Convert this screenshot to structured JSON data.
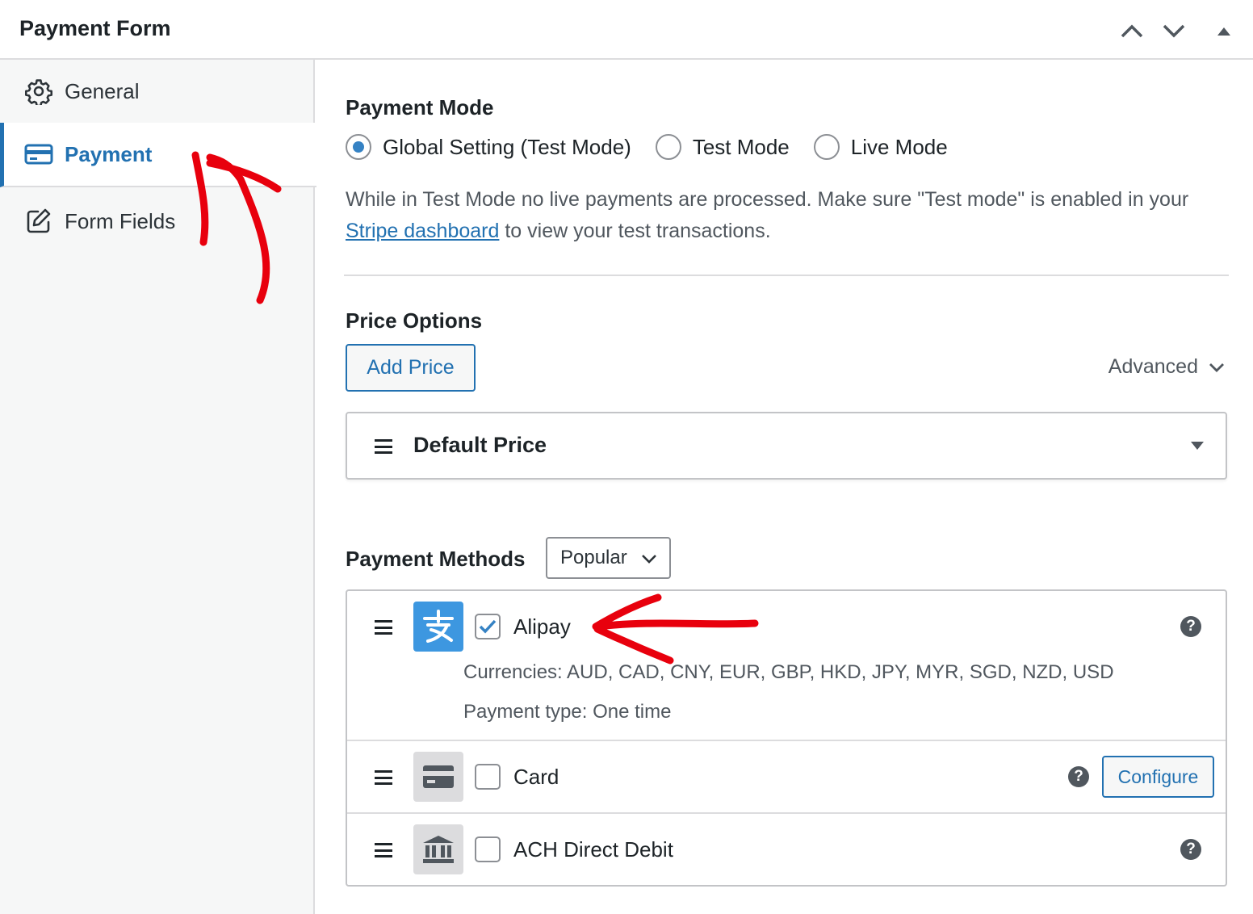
{
  "header": {
    "title": "Payment Form"
  },
  "sidebar": {
    "tabs": [
      {
        "label": "General",
        "icon": "gear-icon"
      },
      {
        "label": "Payment",
        "icon": "credit-card-icon",
        "active": true
      },
      {
        "label": "Form Fields",
        "icon": "edit-icon"
      }
    ]
  },
  "payment_mode": {
    "heading": "Payment Mode",
    "options": [
      {
        "label": "Global Setting (Test Mode)",
        "selected": true
      },
      {
        "label": "Test Mode",
        "selected": false
      },
      {
        "label": "Live Mode",
        "selected": false
      }
    ],
    "description_before": "While in Test Mode no live payments are processed. Make sure \"Test mode\" is enabled in your ",
    "description_link": "Stripe dashboard",
    "description_after": " to view your test transactions."
  },
  "price_options": {
    "heading": "Price Options",
    "add_price_label": "Add Price",
    "advanced_label": "Advanced",
    "default_price_label": "Default Price"
  },
  "payment_methods": {
    "heading": "Payment Methods",
    "filter_value": "Popular",
    "items": [
      {
        "label": "Alipay",
        "checked": true,
        "currencies": "Currencies: AUD, CAD, CNY, EUR, GBP, HKD, JPY, MYR, SGD, NZD, USD",
        "payment_type": "Payment type: One time",
        "icon": "alipay-icon"
      },
      {
        "label": "Card",
        "checked": false,
        "configure_label": "Configure",
        "icon": "credit-card-icon"
      },
      {
        "label": "ACH Direct Debit",
        "checked": false,
        "icon": "bank-icon"
      }
    ]
  },
  "colors": {
    "accent": "#2271b1",
    "annotation": "#e8000d",
    "alipay": "#3d97e0"
  }
}
